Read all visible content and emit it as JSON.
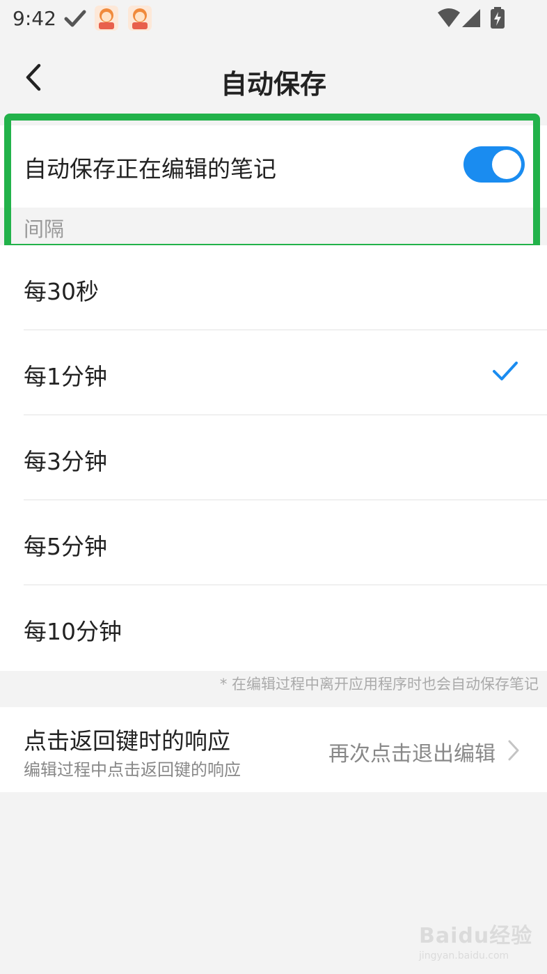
{
  "status_bar": {
    "time": "9:42",
    "icons": [
      "check-icon",
      "app-avatar-icon",
      "app-avatar-icon",
      "wifi-icon",
      "cell-signal-icon",
      "battery-charging-icon"
    ]
  },
  "header": {
    "title": "自动保存",
    "back_icon": "chevron-left-icon"
  },
  "autosave_toggle": {
    "label": "自动保存正在编辑的笔记",
    "enabled": true,
    "accent_color": "#1a8cf0"
  },
  "interval_section": {
    "header": "间隔",
    "options": [
      {
        "label": "每30秒",
        "selected": false
      },
      {
        "label": "每1分钟",
        "selected": true
      },
      {
        "label": "每3分钟",
        "selected": false
      },
      {
        "label": "每5分钟",
        "selected": false
      },
      {
        "label": "每10分钟",
        "selected": false
      }
    ],
    "footnote": "* 在编辑过程中离开应用程序时也会自动保存笔记"
  },
  "back_key_response": {
    "title": "点击返回键时的响应",
    "subtitle": "编辑过程中点击返回键的响应",
    "value": "再次点击退出编辑"
  },
  "highlight_color": "#22b24a",
  "watermark": {
    "main": "Baidu经验",
    "sub": "jingyan.baidu.com"
  }
}
